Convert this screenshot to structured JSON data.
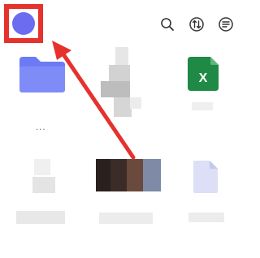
{
  "header": {
    "avatar_color": "#6c6cf0",
    "highlight_color": "#e5322d",
    "icons": [
      "search-icon",
      "sort-icon",
      "menu-icon"
    ]
  },
  "files": [
    {
      "type": "folder",
      "icon": "folder-icon",
      "color": "#6c7bf5",
      "label": "..."
    },
    {
      "type": "blurred",
      "icon": "blurred-thumbnail-icon",
      "label": ""
    },
    {
      "type": "spreadsheet",
      "icon": "excel-icon",
      "color": "#1f8a45",
      "badge": "X",
      "label": ""
    },
    {
      "type": "blurred",
      "icon": "blurred-thumbnail-icon",
      "label": ""
    },
    {
      "type": "image",
      "icon": "image-thumbnail-icon",
      "label": ""
    },
    {
      "type": "document",
      "icon": "document-icon",
      "color": "#dcdff5",
      "label": ""
    }
  ],
  "annotation": {
    "color": "#e5322d",
    "points_to": "avatar"
  }
}
